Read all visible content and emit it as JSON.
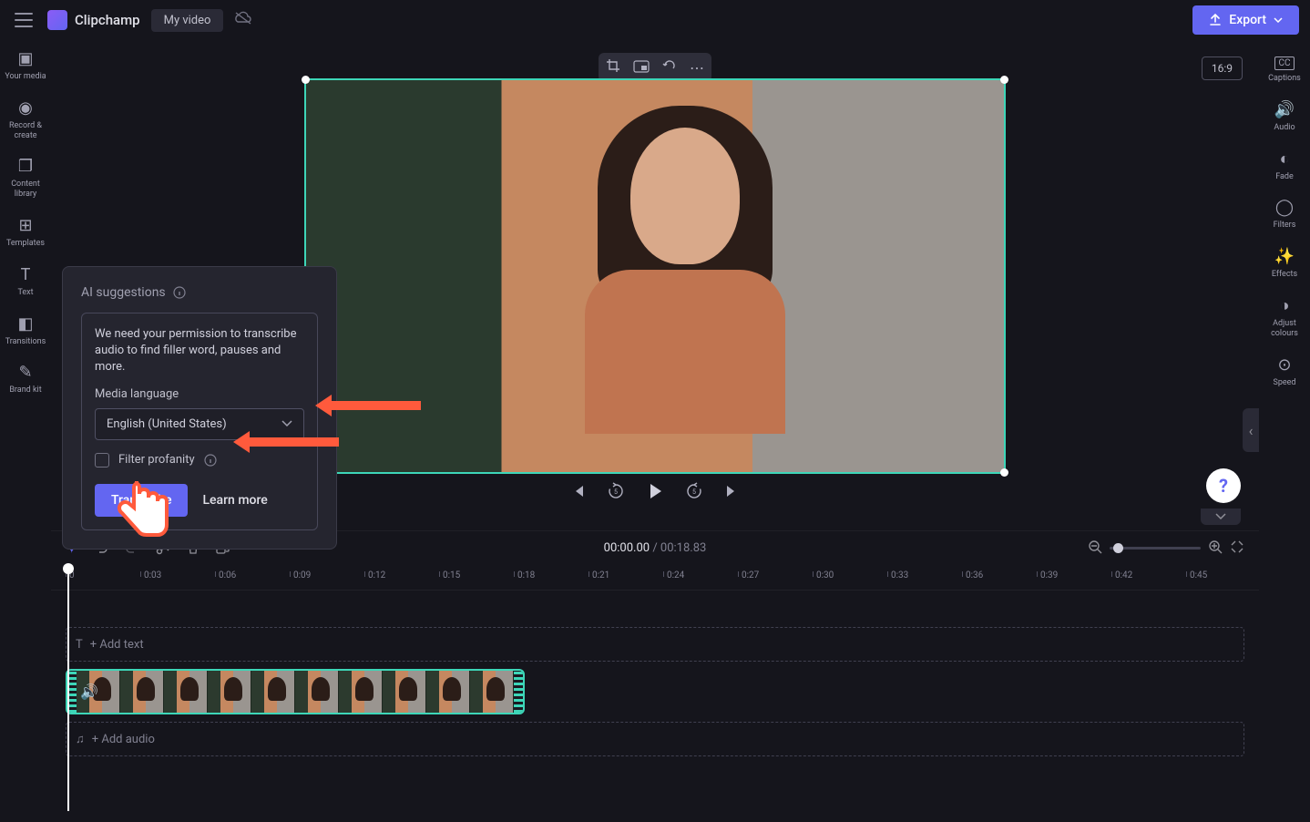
{
  "header": {
    "brand": "Clipchamp",
    "project_name": "My video",
    "export_label": "Export"
  },
  "left_sidebar": [
    {
      "id": "your-media",
      "label": "Your media",
      "glyph": "▣"
    },
    {
      "id": "record",
      "label": "Record & create",
      "glyph": "◉"
    },
    {
      "id": "content-library",
      "label": "Content library",
      "glyph": "❐"
    },
    {
      "id": "templates",
      "label": "Templates",
      "glyph": "⊞"
    },
    {
      "id": "text",
      "label": "Text",
      "glyph": "T"
    },
    {
      "id": "transitions",
      "label": "Transitions",
      "glyph": "◧"
    },
    {
      "id": "brand-kit",
      "label": "Brand kit",
      "glyph": "✎"
    }
  ],
  "right_sidebar": [
    {
      "id": "captions",
      "label": "Captions",
      "glyph": "CC"
    },
    {
      "id": "audio",
      "label": "Audio",
      "glyph": "🔊"
    },
    {
      "id": "fade",
      "label": "Fade",
      "glyph": "◐"
    },
    {
      "id": "filters",
      "label": "Filters",
      "glyph": "◯"
    },
    {
      "id": "effects",
      "label": "Effects",
      "glyph": "✨"
    },
    {
      "id": "adjust-colours",
      "label": "Adjust colours",
      "glyph": "◑"
    },
    {
      "id": "speed",
      "label": "Speed",
      "glyph": "⊙"
    }
  ],
  "preview": {
    "aspect": "16:9"
  },
  "ai_panel": {
    "title": "AI suggestions",
    "message": "We need your permission to transcribe audio to find filler word, pauses and more.",
    "media_language_label": "Media language",
    "language_value": "English (United States)",
    "filter_profanity_label": "Filter profanity",
    "transcribe_label": "Transcribe",
    "learn_more_label": "Learn more"
  },
  "playback": {
    "current": "00:00.00",
    "total": "00:18.83"
  },
  "timeline": {
    "ticks": [
      "0",
      "0:03",
      "0:06",
      "0:09",
      "0:12",
      "0:15",
      "0:18",
      "0:21",
      "0:24",
      "0:27",
      "0:30",
      "0:33",
      "0:36",
      "0:39",
      "0:42",
      "0:45"
    ],
    "add_text_label": "+ Add text",
    "add_audio_label": "+ Add audio"
  },
  "help": "?"
}
